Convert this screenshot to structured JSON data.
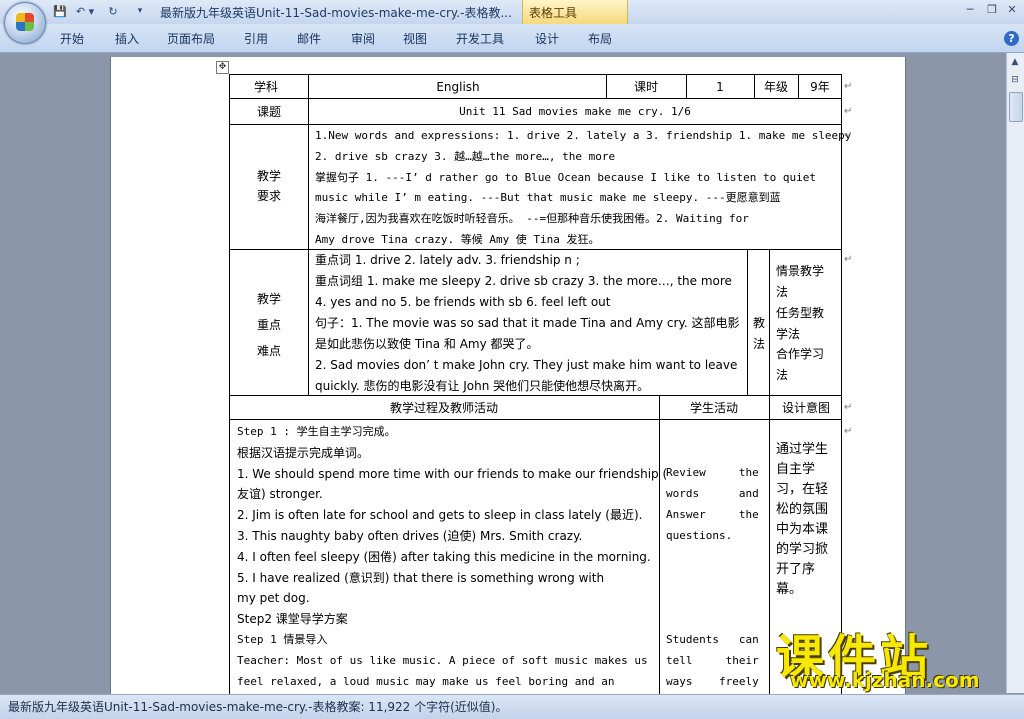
{
  "window": {
    "title": "最新版九年级英语Unit-11-Sad-movies-make-me-cry.-表格教...",
    "contextual_tab": "表格工具",
    "controls": {
      "minimize": "─",
      "restore": "❐",
      "close": "✕"
    }
  },
  "quick_access": {
    "save": "💾",
    "undo": "↶ ▾",
    "redo": "↻",
    "customize": "▾"
  },
  "ribbon": {
    "tabs": [
      "开始",
      "插入",
      "页面布局",
      "引用",
      "邮件",
      "审阅",
      "视图",
      "开发工具",
      "设计",
      "布局"
    ],
    "help": "?"
  },
  "scrollbar": {
    "up": "▲",
    "ruler": "⊟"
  },
  "document": {
    "move_handle": "✥",
    "header_row": {
      "subject_label": "学科",
      "subject_value": "English",
      "hours_label": "课时",
      "hours_value": "1",
      "grade_label": "年级",
      "grade_value": "9年"
    },
    "topic_row": {
      "label": "课题",
      "value": "Unit  11  Sad  movies  make  me  cry.  1/6"
    },
    "requirements": {
      "label_line1": "教学",
      "label_line2": "要求",
      "lines": [
        "1.New words and expressions: 1. drive 2. lately a 3. friendship 1. make me sleepy",
        "2. drive sb crazy  3. 越…越…the more…, the more",
        "掌握句子 1. ---I’ d rather go to Blue Ocean because I like to listen to quiet",
        "music while I’ m eating.   ---But that music make me sleepy. ---更愿意到蓝",
        "海洋餐厅,因为我喜欢在吃饭时听轻音乐。 --=但那种音乐使我困倦。2. Waiting for",
        "Amy drove Tina crazy. 等候 Amy 使 Tina 发狂。"
      ]
    },
    "key_points": {
      "label_line1": "教学",
      "label_line2": "重点",
      "label_line3": "难点",
      "lines": [
        "重点词 1. drive  2. lately adv. 3. friendship n ;",
        "重点词组 1. make me sleepy 2. drive sb crazy 3.  the more…, the more",
        "4. yes and no 5. be friends with sb  6. feel left out",
        "句子：1. The movie was so sad that it made Tina and Amy cry. 这部电影",
        "是如此悲伤以致使 Tina 和 Amy 都哭了。",
        "2. Sad movies don’ t make John cry. They just make him want to leave",
        "quickly. 悲伤的电影没有让 John 哭他们只能使他想尽快离开。"
      ],
      "method_label_1": "教",
      "method_label_2": "法",
      "methods": [
        "情景教学",
        "法",
        "任务型教",
        "学法",
        "合作学习",
        "法"
      ]
    },
    "process_header": {
      "teacher": "教学过程及教师活动",
      "student": "学生活动",
      "intent": "设计意图"
    },
    "process": {
      "teacher_lines": [
        "Step 1 : 学生自主学习完成。",
        "根据汉语提示完成单词。",
        "1. We should spend more time with our friends to make our friendship (",
        "友谊) stronger.",
        "2. Jim is often late for school and gets to sleep in class lately (最近).",
        "3. This naughty baby often drives (迫使) Mrs. Smith crazy.",
        "4. I often feel sleepy (困倦) after taking this medicine in the morning.",
        "5. I have realized (意识到) that there is something wrong with",
        "    my pet dog.",
        "Step2 课堂导学方案",
        "Step 1 情景导入",
        "Teacher: Most of us like music. A piece of soft music makes us",
        "feel relaxed, a loud music may make us feel boring and an"
      ],
      "student_lines": [
        "",
        "",
        "Review     the",
        "words      and",
        "Answer     the",
        "questions.",
        "",
        "",
        "",
        "",
        "Students   can",
        "tell     their",
        "ways    freely"
      ],
      "intent_lines": [
        "通过学生",
        "自主学",
        "习，在轻",
        "松的氛围",
        "中为本课",
        "的学习掀",
        "开了序",
        "幕。"
      ]
    },
    "paragraph_mark": "↵"
  },
  "watermark": {
    "brand": "课件站",
    "url": "www.kjzhan.com"
  },
  "statusbar": {
    "text": "最新版九年级英语Unit-11-Sad-movies-make-me-cry.-表格教案: 11,922 个字符(近似值)。"
  }
}
